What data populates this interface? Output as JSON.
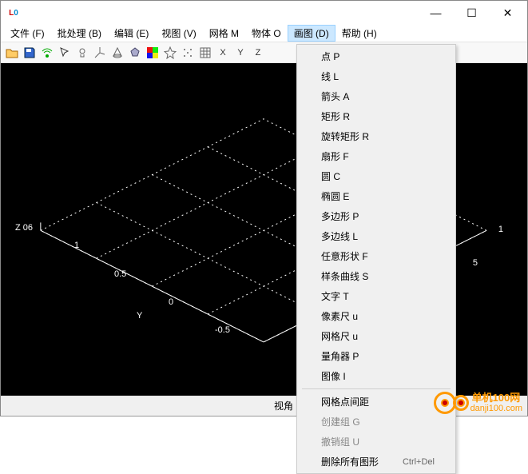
{
  "titlebar": {
    "min": "—",
    "max": "☐",
    "close": "✕"
  },
  "menubar": {
    "items": [
      {
        "label": "文件 (F)"
      },
      {
        "label": "批处理 (B)"
      },
      {
        "label": "编辑 (E)"
      },
      {
        "label": "视图 (V)"
      },
      {
        "label": "网格 M"
      },
      {
        "label": "物体 O"
      },
      {
        "label": "画图 (D)",
        "active": true
      },
      {
        "label": "帮助 (H)"
      }
    ]
  },
  "dropdown": {
    "items": [
      {
        "label": "点 P"
      },
      {
        "label": "线 L"
      },
      {
        "label": "箭头 A"
      },
      {
        "label": "矩形 R"
      },
      {
        "label": "旋转矩形 R"
      },
      {
        "label": "扇形 F"
      },
      {
        "label": "圆 C"
      },
      {
        "label": "椭圆 E"
      },
      {
        "label": "多边形 P"
      },
      {
        "label": "多边线 L"
      },
      {
        "label": "任意形状 F"
      },
      {
        "label": "样条曲线 S"
      },
      {
        "label": "文字 T"
      },
      {
        "label": "像素尺 u"
      },
      {
        "label": "网格尺 u"
      },
      {
        "label": "量角器 P"
      },
      {
        "label": "图像 I"
      },
      {
        "sep": true
      },
      {
        "label": "网格点间距"
      },
      {
        "label": "创建组 G",
        "disabled": true
      },
      {
        "label": "撤销组 U",
        "disabled": true
      },
      {
        "label": "删除所有图形",
        "shortcut": "Ctrl+Del"
      }
    ]
  },
  "axes": {
    "z_label": "Z  06",
    "y_label": "Y",
    "ticks_left": [
      "1",
      "0.5",
      "0",
      "-0.5"
    ],
    "ticks_right": [
      "1",
      "5"
    ]
  },
  "statusbar": {
    "section1": "视角"
  },
  "watermark": {
    "name": "单机100网",
    "url": "danji100.com"
  },
  "chart_data": {
    "type": "other",
    "title": "3D isometric wireframe grid",
    "axes": [
      "X",
      "Y",
      "Z"
    ],
    "y_ticks": [
      -0.5,
      0,
      0.5,
      1
    ],
    "x_ticks": [
      0.5,
      1
    ],
    "grid": true,
    "note": "Dotted isometric mesh rendered on black background"
  }
}
